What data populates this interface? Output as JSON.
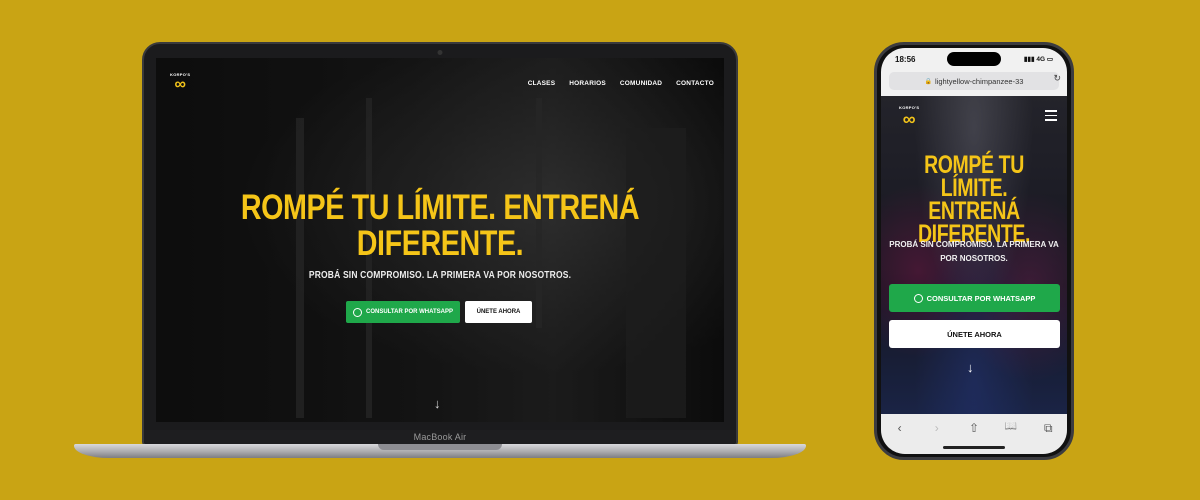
{
  "colors": {
    "background": "#c9a414",
    "accent_yellow": "#f5c518",
    "whatsapp_green": "#1fa84a"
  },
  "laptop": {
    "brand_label": "MacBook Air",
    "site": {
      "logo": {
        "small_text": "KORPO'S",
        "mark": "∞"
      },
      "nav": [
        {
          "label": "CLASES"
        },
        {
          "label": "HORARIOS"
        },
        {
          "label": "COMUNIDAD"
        },
        {
          "label": "CONTACTO"
        }
      ],
      "headline_line1": "ROMPÉ TU LÍMITE. ENTRENÁ",
      "headline_line2": "DIFERENTE.",
      "subtitle": "PROBÁ SIN COMPROMISO. LA PRIMERA VA POR NOSOTROS.",
      "whatsapp_button": "CONSULTAR POR WHATSAPP",
      "join_button": "ÚNETE AHORA",
      "scroll_icon": "arrow-down-icon"
    }
  },
  "phone": {
    "status": {
      "time": "18:56",
      "signal": "4G"
    },
    "url": "lightyellow-chimpanzee-33",
    "site": {
      "logo": {
        "small_text": "KORPO'S",
        "mark": "∞"
      },
      "headline_line1": "ROMPÉ TU LÍMITE.",
      "headline_line2": "ENTRENÁ",
      "headline_line3": "DIFERENTE.",
      "subtitle": "PROBÁ SIN COMPROMISO. LA PRIMERA VA POR NOSOTROS.",
      "whatsapp_button": "CONSULTAR POR WHATSAPP",
      "join_button": "ÚNETE AHORA",
      "menu_icon": "hamburger-icon",
      "scroll_icon": "arrow-down-icon"
    },
    "toolbar": {
      "back": "‹",
      "forward": "›",
      "share": "⇧",
      "bookmarks": "📖",
      "tabs": "⧉"
    }
  }
}
